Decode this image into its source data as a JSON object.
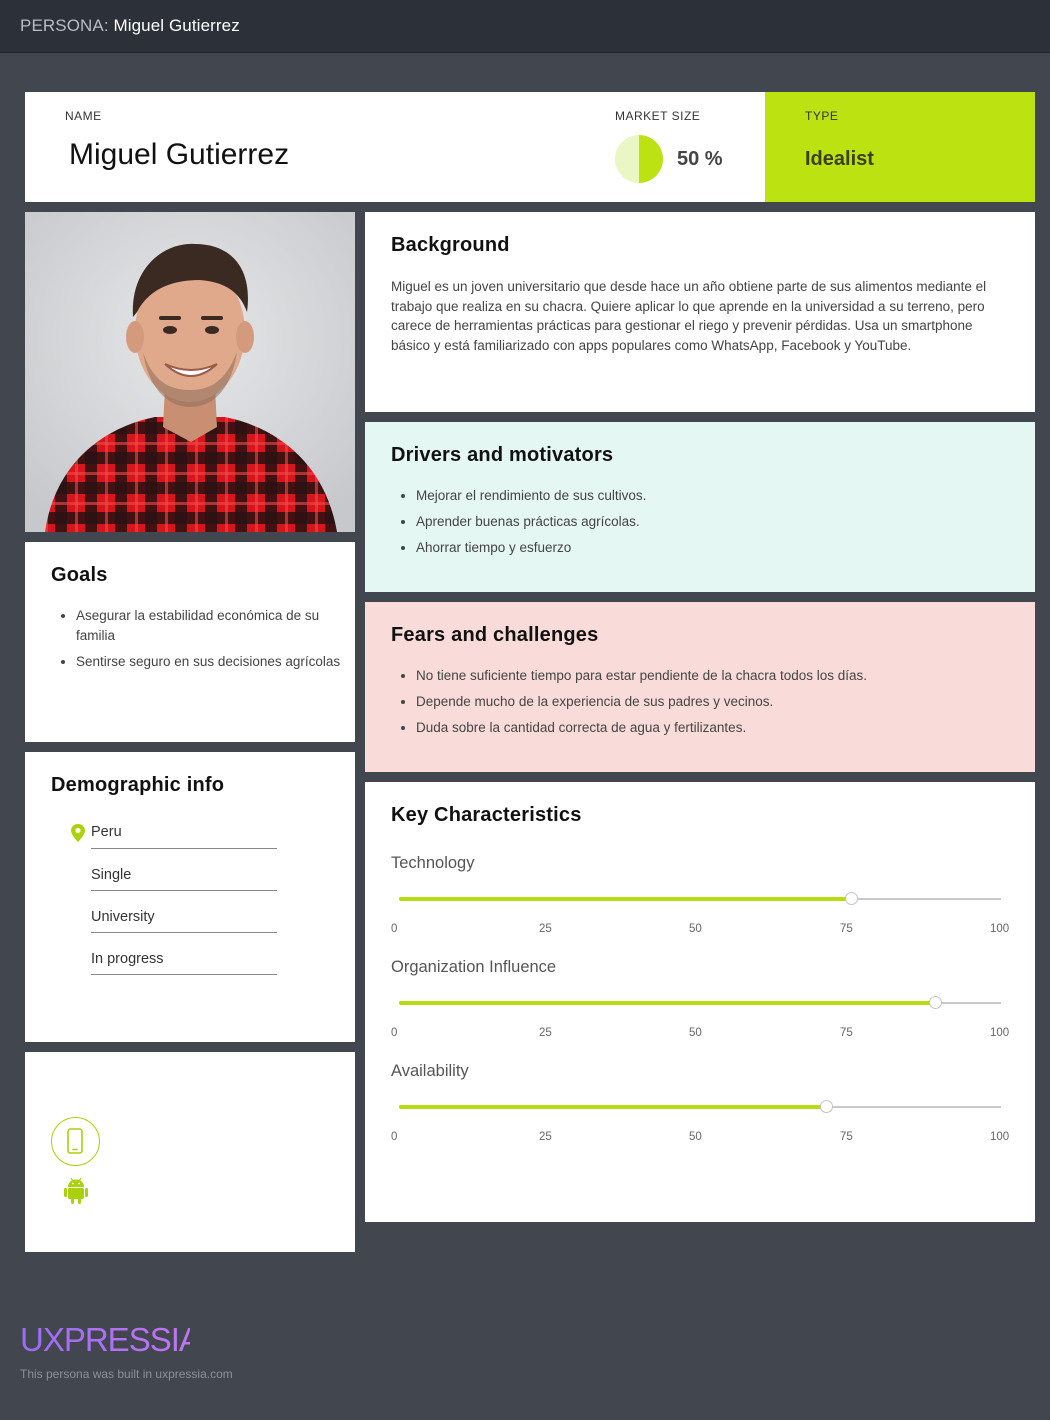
{
  "topbar": {
    "prefix": "PERSONA:",
    "title": "Miguel Gutierrez"
  },
  "header": {
    "name_label": "NAME",
    "name": "Miguel Gutierrez",
    "market_label": "MARKET SIZE",
    "market_value": "50 %",
    "market_fraction": 0.5,
    "type_label": "TYPE",
    "type_value": "Idealist"
  },
  "background": {
    "title": "Background",
    "text": "Miguel es un joven universitario que desde hace un año obtiene parte de sus alimentos mediante el trabajo que realiza en su chacra. Quiere aplicar lo que aprende en la universidad a su terreno, pero carece de herramientas prácticas para gestionar el riego y prevenir pérdidas. Usa un smartphone básico y está familiarizado con apps populares como WhatsApp, Facebook y YouTube."
  },
  "drivers": {
    "title": "Drivers and motivators",
    "items": [
      "Mejorar el rendimiento de sus cultivos.",
      "Aprender buenas prácticas agrícolas.",
      "Ahorrar tiempo y esfuerzo"
    ]
  },
  "fears": {
    "title": "Fears and challenges",
    "items": [
      "No tiene suficiente tiempo para estar pendiente de la chacra todos los días.",
      "Depende mucho de la experiencia de sus padres y vecinos.",
      "Duda sobre la cantidad correcta de agua y fertilizantes."
    ]
  },
  "goals": {
    "title": "Goals",
    "items": [
      "Asegurar la estabilidad económica de su familia",
      "Sentirse seguro en sus decisiones agrícolas"
    ]
  },
  "demographic": {
    "title": "Demographic info",
    "items": [
      "Peru",
      "Single",
      "University",
      "In progress"
    ]
  },
  "devices": {
    "icons": [
      "smartphone-icon",
      "android-icon"
    ]
  },
  "characteristics": {
    "title": "Key Characteristics",
    "ticks": [
      "0",
      "25",
      "50",
      "75",
      "100"
    ],
    "sliders": [
      {
        "label": "Technology",
        "value": 75
      },
      {
        "label": "Organization Influence",
        "value": 89
      },
      {
        "label": "Availability",
        "value": 71
      }
    ]
  },
  "footer": {
    "logo": "UXPRESSIA",
    "note": "This persona was built in uxpressia.com"
  },
  "colors": {
    "accent": "#bde212",
    "page_bg": "#41464f",
    "drivers_bg": "#e5f7f3",
    "fears_bg": "#f9dcd9"
  }
}
